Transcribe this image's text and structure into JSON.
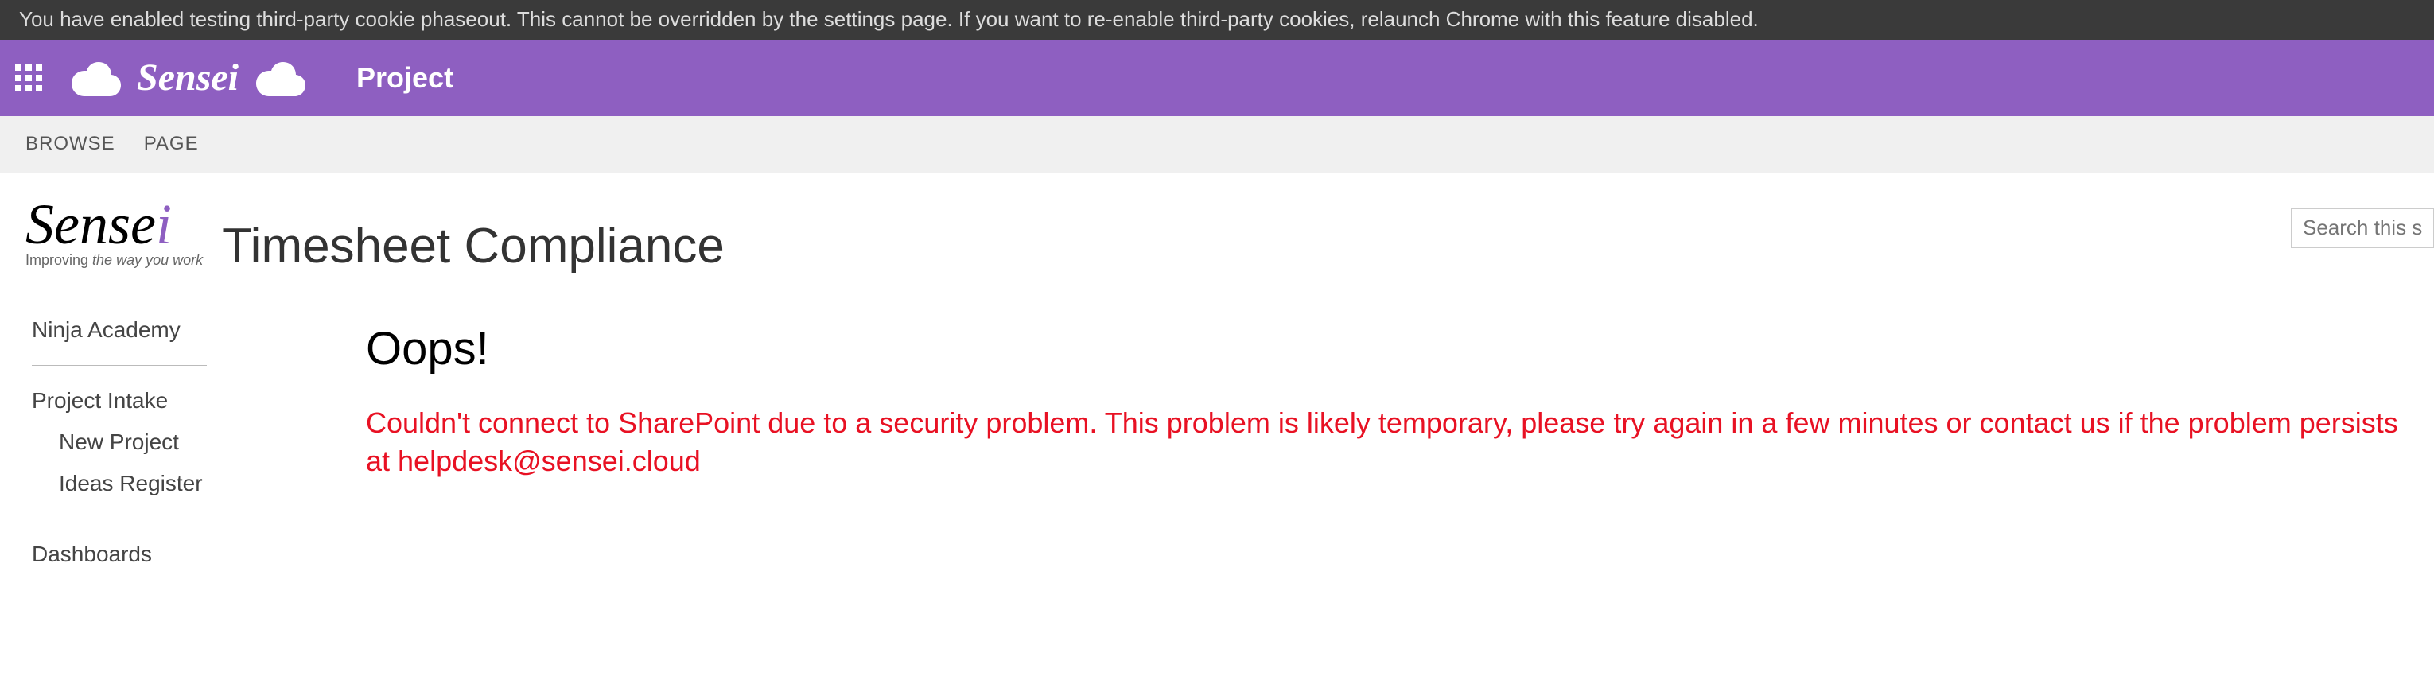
{
  "notice": {
    "text": "You have enabled testing third-party cookie phaseout. This cannot be overridden by the settings page. If you want to re-enable third-party cookies, relaunch Chrome with this feature disabled."
  },
  "appbar": {
    "brand": "Sensei",
    "title": "Project"
  },
  "ribbon": {
    "tabs": [
      {
        "label": "BROWSE"
      },
      {
        "label": "PAGE"
      }
    ]
  },
  "logo": {
    "name": "Sense",
    "accent": "i",
    "tagline_prefix": "Improving ",
    "tagline_em": "the way you work"
  },
  "page": {
    "title": "Timesheet Compliance"
  },
  "search": {
    "placeholder": "Search this site"
  },
  "sidebar": {
    "items": [
      {
        "label": "Ninja Academy",
        "type": "item"
      },
      {
        "type": "divider"
      },
      {
        "label": "Project Intake",
        "type": "item"
      },
      {
        "label": "New Project",
        "type": "sub"
      },
      {
        "label": "Ideas Register",
        "type": "sub"
      },
      {
        "type": "divider"
      },
      {
        "label": "Dashboards",
        "type": "item"
      }
    ]
  },
  "error": {
    "heading": "Oops!",
    "body": "Couldn't connect to SharePoint due to a security problem. This problem is likely temporary, please try again in a few minutes or contact us if the problem persists at helpdesk@sensei.cloud"
  }
}
